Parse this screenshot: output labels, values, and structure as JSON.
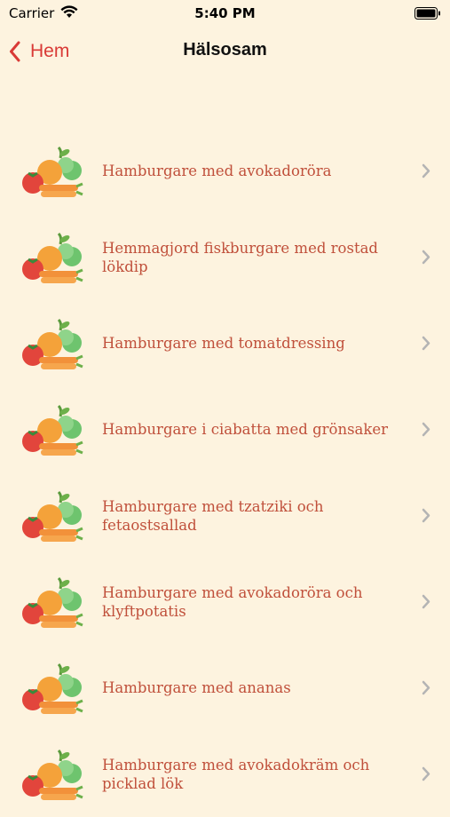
{
  "status": {
    "carrier": "Carrier",
    "time": "5:40 PM"
  },
  "nav": {
    "back_label": "Hem",
    "title": "Hälsosam"
  },
  "recipes": [
    "Hamburgare med avokadoröra",
    "Hemmagjord fiskburgare med rostad lökdip",
    "Hamburgare med tomatdressing",
    "Hamburgare i ciabatta med grönsaker",
    "Hamburgare med tzatziki och fetaostsallad",
    "Hamburgare med avokadoröra och klyftpotatis",
    "Hamburgare med ananas",
    "Hamburgare med avokadokräm och picklad lök"
  ],
  "icons": {
    "thumb": "vegetables-icon",
    "row_chevron": "chevron-right-icon"
  },
  "colors": {
    "accent": "#d93a36",
    "label": "#c0503b",
    "background": "#fdf3df"
  }
}
